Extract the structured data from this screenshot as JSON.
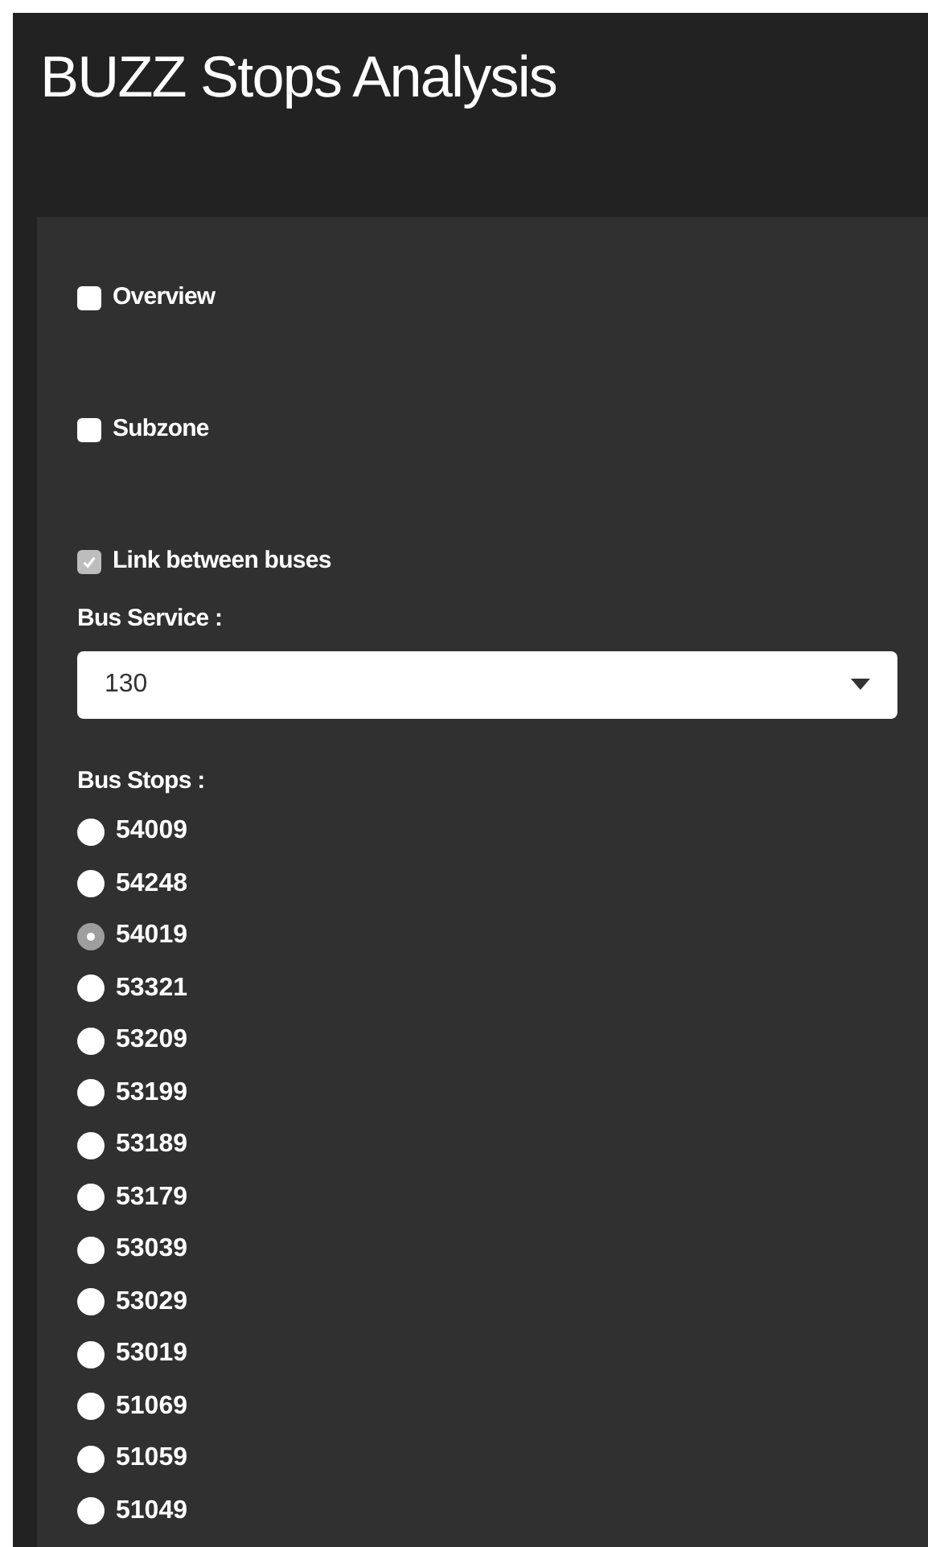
{
  "title": "BUZZ Stops Analysis",
  "checkboxes": [
    {
      "label": "Overview",
      "checked": false
    },
    {
      "label": "Subzone",
      "checked": false
    },
    {
      "label": "Link between buses",
      "checked": true
    }
  ],
  "bus_service": {
    "label": "Bus Service :",
    "value": "130"
  },
  "bus_stops": {
    "label": "Bus Stops :",
    "options": [
      {
        "label": "54009",
        "selected": false
      },
      {
        "label": "54248",
        "selected": false
      },
      {
        "label": "54019",
        "selected": true
      },
      {
        "label": "53321",
        "selected": false
      },
      {
        "label": "53209",
        "selected": false
      },
      {
        "label": "53199",
        "selected": false
      },
      {
        "label": "53189",
        "selected": false
      },
      {
        "label": "53179",
        "selected": false
      },
      {
        "label": "53039",
        "selected": false
      },
      {
        "label": "53029",
        "selected": false
      },
      {
        "label": "53019",
        "selected": false
      },
      {
        "label": "51069",
        "selected": false
      },
      {
        "label": "51059",
        "selected": false
      },
      {
        "label": "51049",
        "selected": false
      }
    ]
  }
}
